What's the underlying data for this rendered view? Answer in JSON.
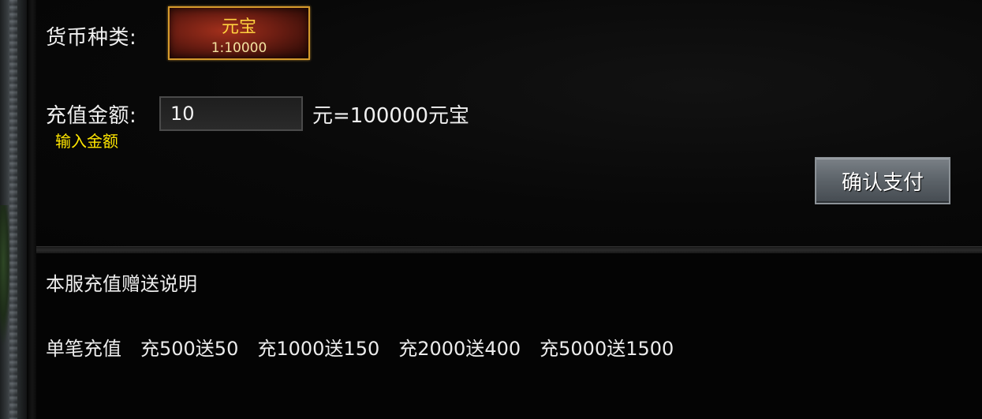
{
  "currency": {
    "label": "货币种类:",
    "selected": {
      "name": "元宝",
      "rate": "1:10000"
    }
  },
  "recharge": {
    "label": "充值金额:",
    "hint": "输入金额",
    "amount_value": "10",
    "conversion_text": "元=100000元宝"
  },
  "confirm": {
    "label": "确认支付"
  },
  "bonus": {
    "title": "本服充值赠送说明",
    "lead": "单笔充值",
    "tiers": [
      "充500送50",
      "充1000送150",
      "充2000送400",
      "充5000送1500"
    ]
  },
  "colors": {
    "hint_yellow": "#ffe600",
    "currency_gold": "#ffd23f",
    "currency_border": "#d59a2c",
    "button_gray": "#5e656b"
  }
}
